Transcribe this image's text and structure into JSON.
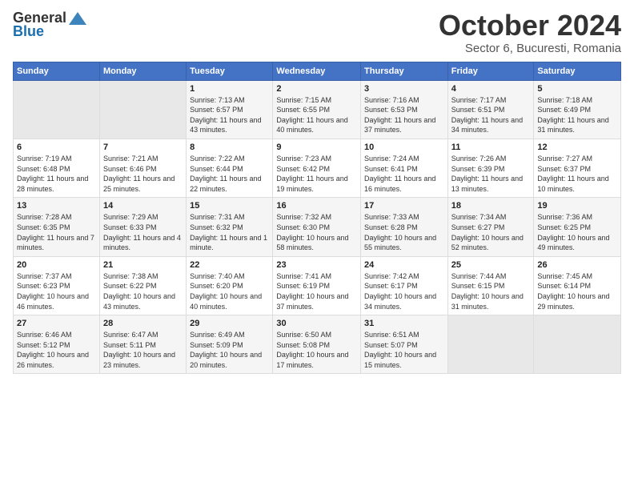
{
  "header": {
    "logo_general": "General",
    "logo_blue": "Blue",
    "month": "October 2024",
    "location": "Sector 6, Bucuresti, Romania"
  },
  "weekdays": [
    "Sunday",
    "Monday",
    "Tuesday",
    "Wednesday",
    "Thursday",
    "Friday",
    "Saturday"
  ],
  "weeks": [
    [
      {
        "day": "",
        "empty": true
      },
      {
        "day": "",
        "empty": true
      },
      {
        "day": "1",
        "sunrise": "Sunrise: 7:13 AM",
        "sunset": "Sunset: 6:57 PM",
        "daylight": "Daylight: 11 hours and 43 minutes."
      },
      {
        "day": "2",
        "sunrise": "Sunrise: 7:15 AM",
        "sunset": "Sunset: 6:55 PM",
        "daylight": "Daylight: 11 hours and 40 minutes."
      },
      {
        "day": "3",
        "sunrise": "Sunrise: 7:16 AM",
        "sunset": "Sunset: 6:53 PM",
        "daylight": "Daylight: 11 hours and 37 minutes."
      },
      {
        "day": "4",
        "sunrise": "Sunrise: 7:17 AM",
        "sunset": "Sunset: 6:51 PM",
        "daylight": "Daylight: 11 hours and 34 minutes."
      },
      {
        "day": "5",
        "sunrise": "Sunrise: 7:18 AM",
        "sunset": "Sunset: 6:49 PM",
        "daylight": "Daylight: 11 hours and 31 minutes."
      }
    ],
    [
      {
        "day": "6",
        "sunrise": "Sunrise: 7:19 AM",
        "sunset": "Sunset: 6:48 PM",
        "daylight": "Daylight: 11 hours and 28 minutes."
      },
      {
        "day": "7",
        "sunrise": "Sunrise: 7:21 AM",
        "sunset": "Sunset: 6:46 PM",
        "daylight": "Daylight: 11 hours and 25 minutes."
      },
      {
        "day": "8",
        "sunrise": "Sunrise: 7:22 AM",
        "sunset": "Sunset: 6:44 PM",
        "daylight": "Daylight: 11 hours and 22 minutes."
      },
      {
        "day": "9",
        "sunrise": "Sunrise: 7:23 AM",
        "sunset": "Sunset: 6:42 PM",
        "daylight": "Daylight: 11 hours and 19 minutes."
      },
      {
        "day": "10",
        "sunrise": "Sunrise: 7:24 AM",
        "sunset": "Sunset: 6:41 PM",
        "daylight": "Daylight: 11 hours and 16 minutes."
      },
      {
        "day": "11",
        "sunrise": "Sunrise: 7:26 AM",
        "sunset": "Sunset: 6:39 PM",
        "daylight": "Daylight: 11 hours and 13 minutes."
      },
      {
        "day": "12",
        "sunrise": "Sunrise: 7:27 AM",
        "sunset": "Sunset: 6:37 PM",
        "daylight": "Daylight: 11 hours and 10 minutes."
      }
    ],
    [
      {
        "day": "13",
        "sunrise": "Sunrise: 7:28 AM",
        "sunset": "Sunset: 6:35 PM",
        "daylight": "Daylight: 11 hours and 7 minutes."
      },
      {
        "day": "14",
        "sunrise": "Sunrise: 7:29 AM",
        "sunset": "Sunset: 6:33 PM",
        "daylight": "Daylight: 11 hours and 4 minutes."
      },
      {
        "day": "15",
        "sunrise": "Sunrise: 7:31 AM",
        "sunset": "Sunset: 6:32 PM",
        "daylight": "Daylight: 11 hours and 1 minute."
      },
      {
        "day": "16",
        "sunrise": "Sunrise: 7:32 AM",
        "sunset": "Sunset: 6:30 PM",
        "daylight": "Daylight: 10 hours and 58 minutes."
      },
      {
        "day": "17",
        "sunrise": "Sunrise: 7:33 AM",
        "sunset": "Sunset: 6:28 PM",
        "daylight": "Daylight: 10 hours and 55 minutes."
      },
      {
        "day": "18",
        "sunrise": "Sunrise: 7:34 AM",
        "sunset": "Sunset: 6:27 PM",
        "daylight": "Daylight: 10 hours and 52 minutes."
      },
      {
        "day": "19",
        "sunrise": "Sunrise: 7:36 AM",
        "sunset": "Sunset: 6:25 PM",
        "daylight": "Daylight: 10 hours and 49 minutes."
      }
    ],
    [
      {
        "day": "20",
        "sunrise": "Sunrise: 7:37 AM",
        "sunset": "Sunset: 6:23 PM",
        "daylight": "Daylight: 10 hours and 46 minutes."
      },
      {
        "day": "21",
        "sunrise": "Sunrise: 7:38 AM",
        "sunset": "Sunset: 6:22 PM",
        "daylight": "Daylight: 10 hours and 43 minutes."
      },
      {
        "day": "22",
        "sunrise": "Sunrise: 7:40 AM",
        "sunset": "Sunset: 6:20 PM",
        "daylight": "Daylight: 10 hours and 40 minutes."
      },
      {
        "day": "23",
        "sunrise": "Sunrise: 7:41 AM",
        "sunset": "Sunset: 6:19 PM",
        "daylight": "Daylight: 10 hours and 37 minutes."
      },
      {
        "day": "24",
        "sunrise": "Sunrise: 7:42 AM",
        "sunset": "Sunset: 6:17 PM",
        "daylight": "Daylight: 10 hours and 34 minutes."
      },
      {
        "day": "25",
        "sunrise": "Sunrise: 7:44 AM",
        "sunset": "Sunset: 6:15 PM",
        "daylight": "Daylight: 10 hours and 31 minutes."
      },
      {
        "day": "26",
        "sunrise": "Sunrise: 7:45 AM",
        "sunset": "Sunset: 6:14 PM",
        "daylight": "Daylight: 10 hours and 29 minutes."
      }
    ],
    [
      {
        "day": "27",
        "sunrise": "Sunrise: 6:46 AM",
        "sunset": "Sunset: 5:12 PM",
        "daylight": "Daylight: 10 hours and 26 minutes."
      },
      {
        "day": "28",
        "sunrise": "Sunrise: 6:47 AM",
        "sunset": "Sunset: 5:11 PM",
        "daylight": "Daylight: 10 hours and 23 minutes."
      },
      {
        "day": "29",
        "sunrise": "Sunrise: 6:49 AM",
        "sunset": "Sunset: 5:09 PM",
        "daylight": "Daylight: 10 hours and 20 minutes."
      },
      {
        "day": "30",
        "sunrise": "Sunrise: 6:50 AM",
        "sunset": "Sunset: 5:08 PM",
        "daylight": "Daylight: 10 hours and 17 minutes."
      },
      {
        "day": "31",
        "sunrise": "Sunrise: 6:51 AM",
        "sunset": "Sunset: 5:07 PM",
        "daylight": "Daylight: 10 hours and 15 minutes."
      },
      {
        "day": "",
        "empty": true
      },
      {
        "day": "",
        "empty": true
      }
    ]
  ]
}
